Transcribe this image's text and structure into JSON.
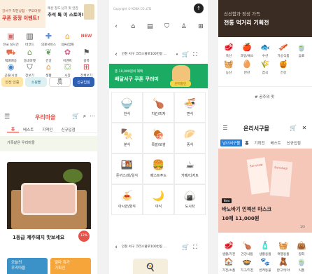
{
  "panel1_top": {
    "promo_line1": "강서구 착한상점 - 부모마켓",
    "promo_line2": "쿠폰 증정 이벤트!",
    "card_line1": "예산 정도 남기 맛 안감",
    "card_line2": "추석 특 이 스토어!",
    "icons": [
      {
        "icon": "box-icon",
        "label": "전국 실시간",
        "color": "#d96a6a"
      },
      {
        "icon": "barcode-icon",
        "label": "바코드",
        "color": "#444"
      },
      {
        "icon": "medical-icon",
        "label": "의료서비스",
        "color": "#5a8fd6"
      },
      {
        "icon": "hanger-icon",
        "label": "의류/잡화",
        "color": "#e0a33a"
      },
      {
        "icon": "badge-icon",
        "label": "NEW",
        "color": "#e85c5c"
      }
    ],
    "icons2": [
      {
        "icon": "truck-icon",
        "label": "택배배송",
        "color": "#e06b4a"
      },
      {
        "icon": "shop-icon",
        "label": "동네마켓",
        "color": "#6a9a4d"
      },
      {
        "icon": "leaf-icon",
        "label": "건강",
        "color": "#5aa35a"
      },
      {
        "icon": "gift-icon",
        "label": "이벤트",
        "color": "#d95b8a"
      },
      {
        "icon": "flag-icon",
        "label": "골목",
        "color": "#555"
      }
    ],
    "icons3": [
      {
        "icon": "stadium-icon",
        "label": "공원/시설",
        "color": "#3f7fc9"
      },
      {
        "icon": "cart-icon",
        "label": "장보기",
        "color": "#4a4a4a"
      },
      {
        "icon": "home-icon",
        "label": "생활",
        "color": "#e38a3a"
      },
      {
        "icon": "basket-icon",
        "label": "시장",
        "color": "#6a9a4d"
      },
      {
        "icon": "grid-icon",
        "label": "전체보기",
        "color": "#c94d4d"
      }
    ],
    "banners": [
      "안전 인증",
      "쇼핑몰",
      "장바구니",
      "신규입점"
    ],
    "ribbon": "추모"
  },
  "panel1_main": {
    "logo": "우리마을",
    "tabs": [
      "홈",
      "베스트",
      "지역인",
      "신규입점"
    ],
    "subtitle": "가족같은 우리마을",
    "product_title": "1등급 제주돼지 맛보세요",
    "badge": "12%",
    "next_left": "오늘의",
    "next_left2": "우리마을",
    "next_right": "얼마 특가",
    "next_right2": "기획전"
  },
  "panel2_top": {
    "company": "Copyright © KONA CO.,LTD",
    "nav_icons": [
      "back-icon",
      "home-icon",
      "doc-icon",
      "cart-icon",
      "user-icon",
      "grid-icon"
    ]
  },
  "panel2_main": {
    "location": "인천 서구 크리스탈로100번길 ...",
    "banner_small": "총 10,000원의 혜택",
    "banner_big": "배달서구 쿠폰 꾸러미",
    "sign": "반짝할인",
    "categories": [
      {
        "icon": "🍚",
        "label": "한식"
      },
      {
        "icon": "🍗",
        "label": "치킨/피자"
      },
      {
        "icon": "🍜",
        "label": "면식"
      },
      {
        "icon": "🍢",
        "label": "분식"
      },
      {
        "icon": "🍖",
        "label": "족발/보쌈"
      },
      {
        "icon": "🥟",
        "label": "중식"
      },
      {
        "icon": "🍱",
        "label": "돈까스/회/일식"
      },
      {
        "icon": "🍔",
        "label": "패스트푸드"
      },
      {
        "icon": "☕",
        "label": "카페/디저트"
      },
      {
        "icon": "🍝",
        "label": "아시안/양식"
      },
      {
        "icon": "🌙",
        "label": "야식"
      },
      {
        "icon": "🍙",
        "label": "도시락"
      }
    ],
    "next_location": "인천 서구 크리스탈로100번길 ..."
  },
  "panel3_top": {
    "line1": "신선함과 정성 가득",
    "line2": "전통 먹거리 기획전",
    "icons": [
      {
        "icon": "🥩",
        "label": "축산"
      },
      {
        "icon": "🍎",
        "label": "과일/채소"
      },
      {
        "icon": "🐟",
        "label": "수산"
      },
      {
        "icon": "🥓",
        "label": "가공식품"
      },
      {
        "icon": "🍵",
        "label": "음료"
      }
    ],
    "icons2": [
      {
        "icon": "🧺",
        "label": "농산"
      },
      {
        "icon": "🥚",
        "label": "반찬"
      },
      {
        "icon": "🌾",
        "label": "잡곡"
      },
      {
        "icon": "🍯",
        "label": "건강"
      }
    ],
    "hashtag": "# 공주의 맛"
  },
  "panel3_main": {
    "logo": "온리서구몰",
    "tabs": [
      "남녀서구몰",
      "홈",
      "기획전",
      "베스트",
      "신규입점"
    ],
    "product_tag": "New",
    "product_title": "바노바기 인젝션 마스크",
    "price": "10매 11,000원",
    "page": "1/3",
    "box_text": "Banobagi",
    "icons": [
      {
        "icon": "🥩",
        "label": "생활/가전"
      },
      {
        "icon": "🍗",
        "label": "건강식품"
      },
      {
        "icon": "🧴",
        "label": "생활용품"
      },
      {
        "icon": "🧺",
        "label": "여행용품"
      },
      {
        "icon": "👜",
        "label": "잡화"
      }
    ],
    "icons2": [
      {
        "icon": "🏠",
        "label": "가전/소품"
      },
      {
        "icon": "🍲",
        "label": "가구/가전"
      },
      {
        "icon": "🐾",
        "label": "반려동물"
      },
      {
        "icon": "🧸",
        "label": "완구/유아"
      },
      {
        "icon": "🍵",
        "label": "식품"
      }
    ]
  }
}
